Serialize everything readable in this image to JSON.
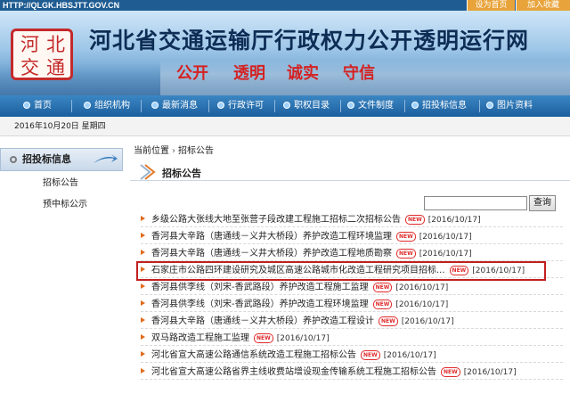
{
  "header": {
    "url": "HTTP://QLGK.HBSJTT.GOV.CN",
    "set_home": "设为首页",
    "add_favorite": "加入收藏",
    "site_title": "河北省交通运输厅行政权力公开透明运行网",
    "seal": [
      "河",
      "北",
      "交",
      "通"
    ],
    "slogans": [
      "公开",
      "透明",
      "诚实",
      "守信"
    ]
  },
  "nav": {
    "items": [
      "首页",
      "组织机构",
      "最新消息",
      "行政许可",
      "职权目录",
      "文件制度",
      "招投标信息",
      "图片资料"
    ]
  },
  "date_text": "2016年10月20日 星期四",
  "sidebar": {
    "heading": "招投标信息",
    "links": [
      "招标公告",
      "预中标公示"
    ]
  },
  "main": {
    "breadcrumb": [
      "当前位置",
      "招标公告"
    ],
    "section_title": "招标公告",
    "search_button": "查询",
    "new_badge": "NEW",
    "items": [
      {
        "title": "乡级公路大张线大地至张营子段改建工程施工招标二次招标公告",
        "date": "[2016/10/17]"
      },
      {
        "title": "香河县大辛路（唐通线－义井大桥段）养护改造工程环境监理",
        "date": "[2016/10/17]"
      },
      {
        "title": "香河县大辛路（唐通线－义井大桥段）养护改造工程地质勘察",
        "date": "[2016/10/17]"
      },
      {
        "title": "石家庄市公路四环建设研究及城区高速公路城市化改造工程研究项目招标...",
        "date": "[2016/10/17]"
      },
      {
        "title": "香河县供李线（刘宋-香武路段）养护改造工程施工监理",
        "date": "[2016/10/17]"
      },
      {
        "title": "香河县供李线（刘宋-香武路段）养护改造工程环境监理",
        "date": "[2016/10/17]"
      },
      {
        "title": "香河县大辛路（唐通线－义井大桥段）养护改造工程设计",
        "date": "[2016/10/17]"
      },
      {
        "title": "双马路改造工程施工监理",
        "date": "[2016/10/17]"
      },
      {
        "title": "河北省宣大高速公路通信系统改造工程施工招标公告",
        "date": "[2016/10/17]"
      },
      {
        "title": "河北省宣大高速公路省界主线收费站增设现金传输系统工程施工招标公告",
        "date": "[2016/10/17]"
      }
    ]
  }
}
